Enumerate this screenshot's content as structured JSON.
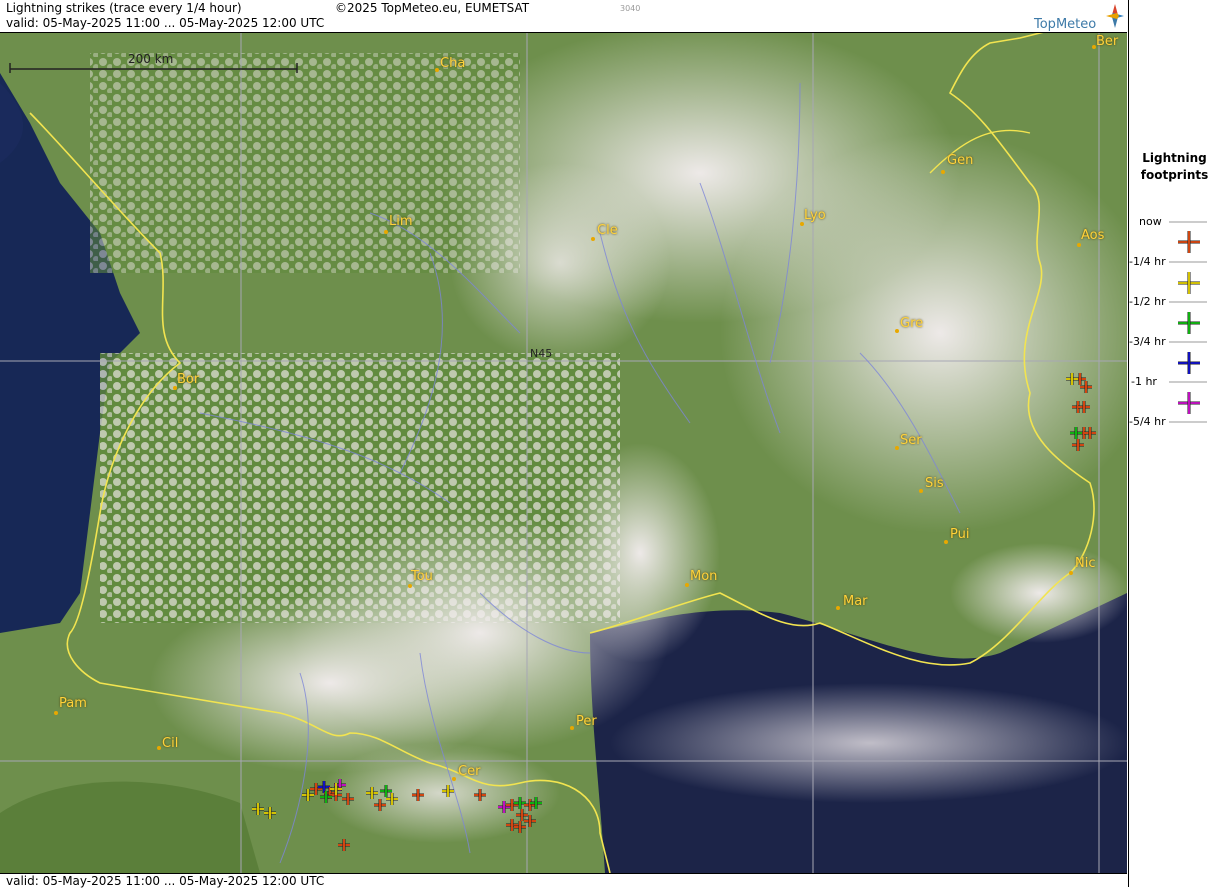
{
  "header": {
    "title": "Lightning strikes (trace every 1/4 hour)",
    "copyright": "©2025 TopMeteo.eu, EUMETSAT",
    "code": "3040",
    "valid": "valid:  05-May-2025 11:00 ... 05-May-2025 12:00 UTC",
    "logo": "TopMeteo"
  },
  "map": {
    "scale_label": "200 km",
    "grid_label": "N45",
    "cities": [
      "Ber",
      "Cha",
      "Gen",
      "Lim",
      "Cle",
      "Lyo",
      "Aos",
      "Gre",
      "Bor",
      "Ser",
      "Sis",
      "Pui",
      "Tou",
      "Mon",
      "Mar",
      "Nic",
      "Pam",
      "Per",
      "Cil",
      "Cer"
    ]
  },
  "legend": {
    "title_line1": "Lightning",
    "title_line2": "footprints",
    "items": [
      {
        "label": "now",
        "color": "#e34a10"
      },
      {
        "label": "-1/4 hr",
        "color": "#e8d400"
      },
      {
        "label": "-1/2 hr",
        "color": "#10c010"
      },
      {
        "label": "-3/4 hr",
        "color": "#1010d0"
      },
      {
        "label": "-1 hr",
        "color": "#d010d0"
      },
      {
        "label": "-5/4 hr",
        "color": ""
      }
    ]
  },
  "footer": {
    "valid": "valid:  05-May-2025 11:00 ... 05-May-2025 12:00 UTC"
  }
}
